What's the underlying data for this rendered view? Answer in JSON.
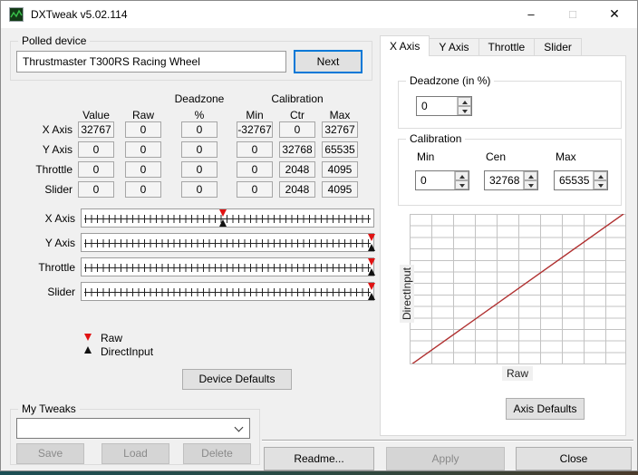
{
  "window": {
    "title": "DXTweak v5.02.114"
  },
  "titlebar_controls": {
    "minimize": "–",
    "maximize": "□",
    "close": "✕"
  },
  "polled_device": {
    "label": "Polled device",
    "device_name": "Thrustmaster T300RS Racing Wheel",
    "next_button": "Next"
  },
  "table": {
    "deadzone_header": "Deadzone",
    "calibration_header": "Calibration",
    "columns": [
      "Value",
      "Raw",
      "%",
      "Min",
      "Ctr",
      "Max"
    ],
    "rows": [
      {
        "label": "X Axis",
        "values": [
          "32767",
          "0",
          "0",
          "-32767",
          "0",
          "32767"
        ]
      },
      {
        "label": "Y Axis",
        "values": [
          "0",
          "0",
          "0",
          "0",
          "32768",
          "65535"
        ]
      },
      {
        "label": "Throttle",
        "values": [
          "0",
          "0",
          "0",
          "0",
          "2048",
          "4095"
        ]
      },
      {
        "label": "Slider",
        "values": [
          "0",
          "0",
          "0",
          "0",
          "2048",
          "4095"
        ]
      }
    ]
  },
  "sliders": {
    "rows": [
      {
        "label": "X Axis",
        "raw_pct": 48.4,
        "directinput_pct": 48.4
      },
      {
        "label": "Y Axis",
        "raw_pct": 99.4,
        "directinput_pct": 99.4
      },
      {
        "label": "Throttle",
        "raw_pct": 99.4,
        "directinput_pct": 99.4
      },
      {
        "label": "Slider",
        "raw_pct": 99.4,
        "directinput_pct": 99.4
      }
    ],
    "legend": {
      "raw": "Raw",
      "directinput": "DirectInput"
    }
  },
  "device_defaults_button": "Device Defaults",
  "my_tweaks": {
    "label": "My Tweaks",
    "combo_value": "",
    "save": "Save",
    "load": "Load",
    "delete": "Delete"
  },
  "tabs": [
    "X Axis",
    "Y Axis",
    "Throttle",
    "Slider"
  ],
  "axis_panel": {
    "deadzone": {
      "label": "Deadzone (in %)",
      "value": "0"
    },
    "calibration": {
      "label": "Calibration",
      "min_label": "Min",
      "cen_label": "Cen",
      "max_label": "Max",
      "min": "0",
      "cen": "32768",
      "max": "65535"
    },
    "axis_defaults_button": "Axis Defaults"
  },
  "bottom_buttons": {
    "readme": "Readme...",
    "apply": "Apply",
    "close": "Close"
  },
  "chart_data": {
    "type": "line",
    "title": "",
    "xlabel": "Raw",
    "ylabel": "DirectInput",
    "x": [
      0,
      65535
    ],
    "y": [
      0,
      65535
    ],
    "xlim": [
      0,
      65535
    ],
    "ylim": [
      0,
      65535
    ],
    "grid": true,
    "line_color": "#b03030"
  },
  "colors": {
    "accent_focus": "#0078d7",
    "raw_marker": "#e01212",
    "directinput_marker": "#111111",
    "chart_line": "#b03030",
    "window_bg": "#f0f0f0"
  }
}
